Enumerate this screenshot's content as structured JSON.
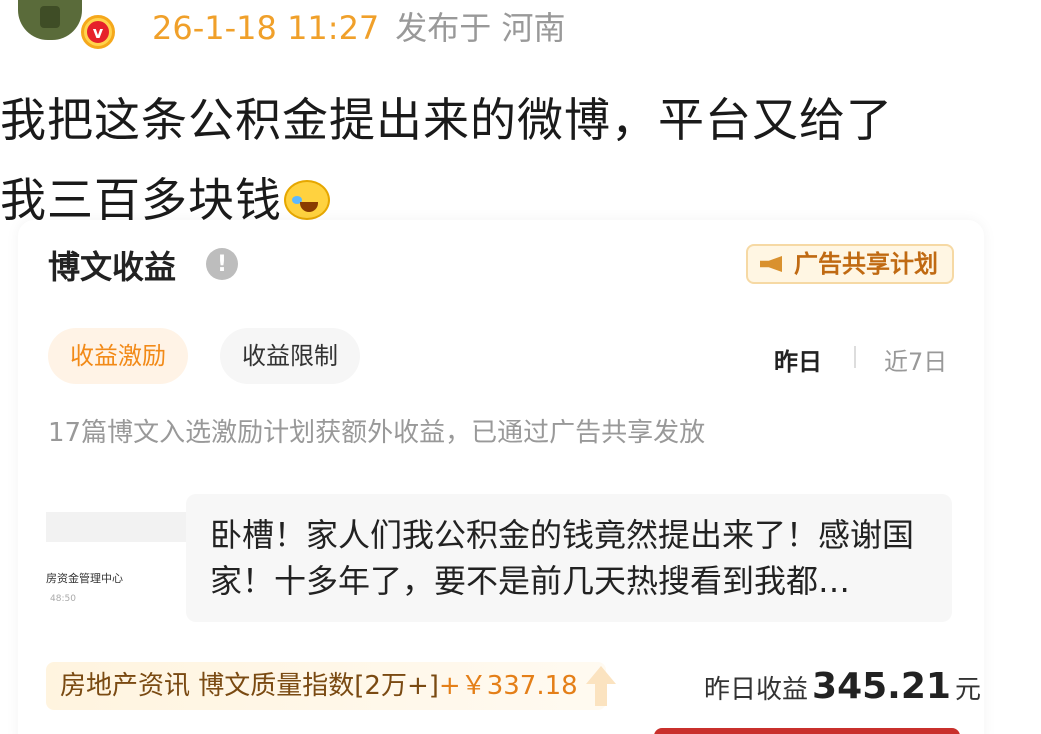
{
  "post": {
    "time": "26-1-18 11:27",
    "location": "发布于 河南",
    "text_line1": "我把这条公积金提出来的微博，平台又给了",
    "text_line2": "我三百多块钱",
    "emoji": "laugh-cry-icon"
  },
  "card": {
    "title": "博文收益",
    "ad_plan_label": "广告共享计划",
    "tabs": [
      {
        "label": "收益激励",
        "active": true
      },
      {
        "label": "收益限制",
        "active": false
      }
    ],
    "periods": [
      {
        "label": "昨日",
        "selected": true
      },
      {
        "label": "近7日",
        "selected": false
      }
    ],
    "notice": "17篇博文入选激励计划获额外收益，已通过广告共享发放",
    "item": {
      "thumb_org": "房资金管理中心",
      "thumb_time": "48:50",
      "quote": "卧槽！家人们我公积金的钱竟然提出来了！感谢国家！十多年了，要不是前几天热搜看到我都…"
    },
    "earn": {
      "category": "房地产资讯",
      "index_label": "博文质量指数[2万+]",
      "amount": "+￥337.18",
      "yesterday_label": "昨日收益",
      "yesterday_value": "345.21",
      "unit": "元"
    }
  },
  "colors": {
    "accent_orange": "#f28a18",
    "time_orange": "#f0a02a",
    "badge_red": "#e6212a"
  }
}
